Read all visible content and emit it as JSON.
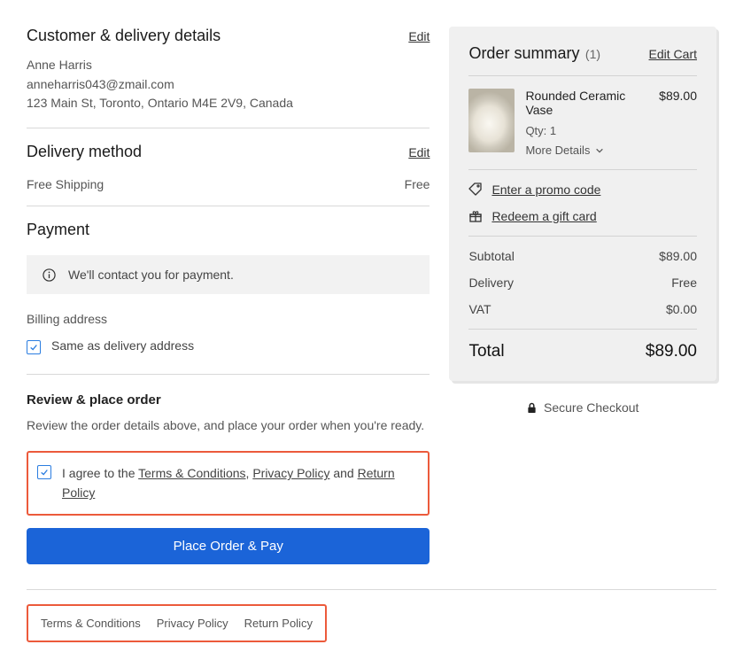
{
  "customer": {
    "heading": "Customer & delivery details",
    "edit": "Edit",
    "name": "Anne Harris",
    "email": "anneharris043@zmail.com",
    "address": "123 Main St, Toronto, Ontario M4E 2V9, Canada"
  },
  "delivery": {
    "heading": "Delivery method",
    "edit": "Edit",
    "method": "Free Shipping",
    "price": "Free"
  },
  "payment": {
    "heading": "Payment",
    "info": "We'll contact you for payment.",
    "billing_label": "Billing address",
    "same_as": "Same as delivery address"
  },
  "review": {
    "heading": "Review & place order",
    "desc": "Review the order details above, and place your order when you're ready.",
    "agree_prefix": "I agree to the ",
    "terms": "Terms & Conditions",
    "comma": ", ",
    "privacy": "Privacy Policy",
    "and": " and ",
    "return": "Return Policy",
    "button": "Place Order & Pay"
  },
  "summary": {
    "heading": "Order summary",
    "count": "(1)",
    "edit_cart": "Edit Cart",
    "item": {
      "name": "Rounded Ceramic Vase",
      "qty": "Qty: 1",
      "more": "More Details",
      "price": "$89.00"
    },
    "promo": "Enter a promo code",
    "gift": "Redeem a gift card",
    "subtotal_label": "Subtotal",
    "subtotal_value": "$89.00",
    "delivery_label": "Delivery",
    "delivery_value": "Free",
    "vat_label": "VAT",
    "vat_value": "$0.00",
    "total_label": "Total",
    "total_value": "$89.00"
  },
  "secure": "Secure Checkout",
  "footer": {
    "terms": "Terms & Conditions",
    "privacy": "Privacy Policy",
    "return": "Return Policy"
  }
}
